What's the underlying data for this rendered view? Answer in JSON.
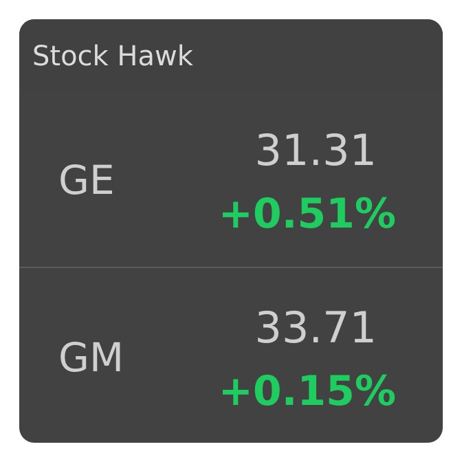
{
  "app": {
    "title": "Stock Hawk"
  },
  "colors": {
    "widget_background": "#424242",
    "divider": "#5b5b5b",
    "text_primary": "#cfcfcf",
    "change_positive": "#1ecc5f"
  },
  "stocks": [
    {
      "symbol": "GE",
      "price": "31.31",
      "change": "+0.51%",
      "trend": "up"
    },
    {
      "symbol": "GM",
      "price": "33.71",
      "change": "+0.15%",
      "trend": "up"
    }
  ]
}
